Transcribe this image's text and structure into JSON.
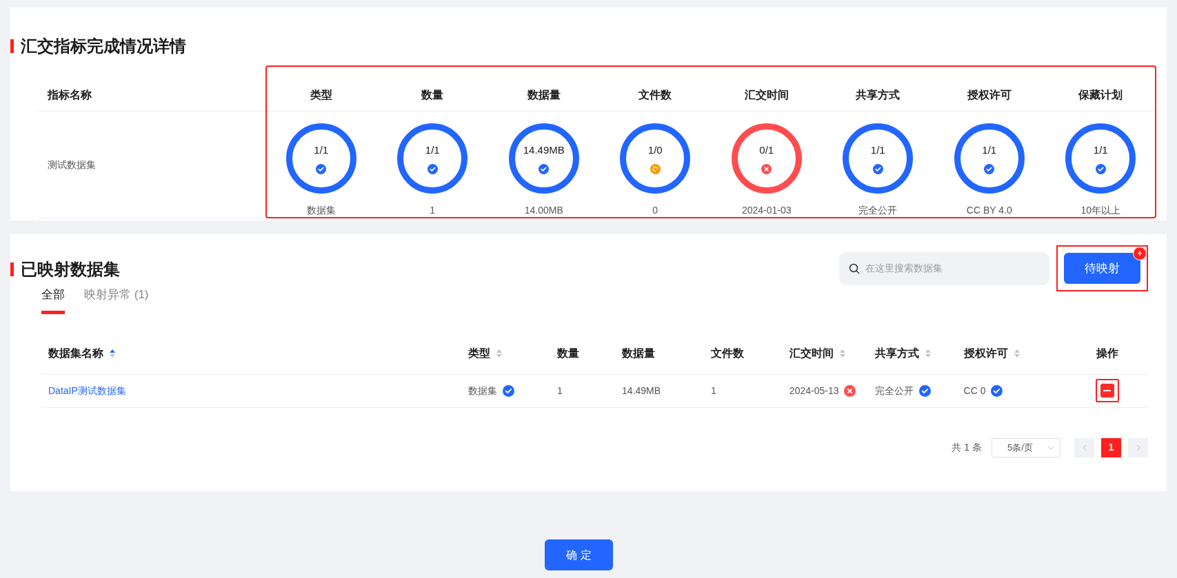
{
  "summary": {
    "title": "汇交指标完成情况详情",
    "name_header": "指标名称",
    "row_name": "测试数据集",
    "highlighted": true,
    "metrics": [
      {
        "label": "类型",
        "ratio": "1/1",
        "kind": "passed",
        "detail": "数据集"
      },
      {
        "label": "数量",
        "ratio": "1/1",
        "kind": "passed",
        "detail": "1"
      },
      {
        "label": "数据量",
        "ratio": "14.49MB",
        "kind": "passed",
        "detail": "14.00MB"
      },
      {
        "label": "文件数",
        "ratio": "1/0",
        "kind": "pending",
        "detail": "0"
      },
      {
        "label": "汇交时间",
        "ratio": "0/1",
        "kind": "failed",
        "detail": "2024-01-03"
      },
      {
        "label": "共享方式",
        "ratio": "1/1",
        "kind": "passed",
        "detail": "完全公开"
      },
      {
        "label": "授权许可",
        "ratio": "1/1",
        "kind": "passed",
        "detail": "CC BY 4.0"
      },
      {
        "label": "保藏计划",
        "ratio": "1/1",
        "kind": "passed",
        "detail": "10年以上"
      }
    ]
  },
  "mapped": {
    "title": "已映射数据集",
    "search": {
      "placeholder": "在这里搜索数据集"
    },
    "pending_button": {
      "label": "待映射",
      "badge": "+",
      "highlighted": true
    },
    "tabs": [
      {
        "label": "全部",
        "selected": true
      },
      {
        "label": "映射异常 (1)",
        "selected": false
      }
    ],
    "columns": [
      {
        "label": "数据集名称",
        "kind": "sortable",
        "sorted": true
      },
      {
        "label": "类型",
        "kind": "sortable",
        "sorted": false
      },
      {
        "label": "数量",
        "kind": "plain"
      },
      {
        "label": "数据量",
        "kind": "plain"
      },
      {
        "label": "文件数",
        "kind": "plain"
      },
      {
        "label": "汇交时间",
        "kind": "sortable",
        "sorted": false
      },
      {
        "label": "共享方式",
        "kind": "sortable",
        "sorted": false
      },
      {
        "label": "授权许可",
        "kind": "sortable",
        "sorted": false
      },
      {
        "label": "操作",
        "kind": "plain"
      }
    ],
    "rows": [
      {
        "cells": [
          {
            "text": "DataIP测试数据集",
            "kind": "link"
          },
          {
            "text": "数据集",
            "passed": true
          },
          {
            "text": "1"
          },
          {
            "text": "14.49MB"
          },
          {
            "text": "1"
          },
          {
            "text": "2024-05-13",
            "passed": false
          },
          {
            "text": "完全公开",
            "passed": true
          },
          {
            "text": "CC 0",
            "passed": true
          },
          {
            "kind": "remove",
            "highlighted": true
          }
        ]
      }
    ],
    "pagination": {
      "total": "共 1 条",
      "page_size": "5条/页",
      "pages": [
        {
          "label": "1",
          "selected": true
        }
      ]
    }
  },
  "confirm_button": "确 定"
}
